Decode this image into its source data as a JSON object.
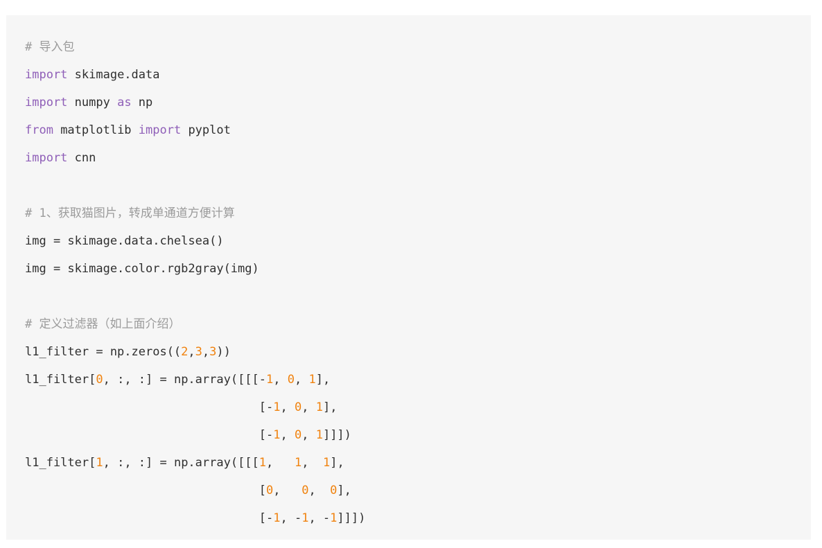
{
  "document": {
    "type": "python-code-block",
    "background_color": "#f6f6f6",
    "page_background_color": "#ffffff",
    "colors": {
      "comment": "#9b9b9b",
      "keyword": "#8f5fb8",
      "number": "#f0820e",
      "text": "#2f2f2f"
    }
  },
  "code": {
    "language": "python",
    "lines": [
      {
        "index": 1,
        "text": "# 导入包",
        "tokens": [
          {
            "t": "# 导入包",
            "c": "tok-com"
          }
        ]
      },
      {
        "index": 2,
        "text": "import skimage.data",
        "tokens": [
          {
            "t": "import",
            "c": "tok-kw"
          },
          {
            "t": " skimage.data",
            "c": "tok-txt"
          }
        ]
      },
      {
        "index": 3,
        "text": "import numpy as np",
        "tokens": [
          {
            "t": "import",
            "c": "tok-kw"
          },
          {
            "t": " numpy ",
            "c": "tok-txt"
          },
          {
            "t": "as",
            "c": "tok-kw"
          },
          {
            "t": " np",
            "c": "tok-txt"
          }
        ]
      },
      {
        "index": 4,
        "text": "from matplotlib import pyplot",
        "tokens": [
          {
            "t": "from",
            "c": "tok-kw"
          },
          {
            "t": " matplotlib ",
            "c": "tok-txt"
          },
          {
            "t": "import",
            "c": "tok-kw"
          },
          {
            "t": " pyplot",
            "c": "tok-txt"
          }
        ]
      },
      {
        "index": 5,
        "text": "import cnn",
        "tokens": [
          {
            "t": "import",
            "c": "tok-kw"
          },
          {
            "t": " cnn",
            "c": "tok-txt"
          }
        ]
      },
      {
        "index": 6,
        "text": "",
        "tokens": []
      },
      {
        "index": 7,
        "text": "# 1、获取猫图片，转成单通道方便计算",
        "tokens": [
          {
            "t": "# 1、获取猫图片，转成单通道方便计算",
            "c": "tok-com"
          }
        ]
      },
      {
        "index": 8,
        "text": "img = skimage.data.chelsea()",
        "tokens": [
          {
            "t": "img = skimage.data.chelsea()",
            "c": "tok-txt"
          }
        ]
      },
      {
        "index": 9,
        "text": "img = skimage.color.rgb2gray(img)",
        "tokens": [
          {
            "t": "img = skimage.color.rgb2gray(img)",
            "c": "tok-txt"
          }
        ]
      },
      {
        "index": 10,
        "text": "",
        "tokens": []
      },
      {
        "index": 11,
        "text": "# 定义过滤器（如上面介绍）",
        "tokens": [
          {
            "t": "# 定义过滤器（如上面介绍）",
            "c": "tok-com"
          }
        ]
      },
      {
        "index": 12,
        "text": "l1_filter = np.zeros((2,3,3))",
        "tokens": [
          {
            "t": "l1_filter = np.zeros((",
            "c": "tok-txt"
          },
          {
            "t": "2",
            "c": "tok-num"
          },
          {
            "t": ",",
            "c": "tok-txt"
          },
          {
            "t": "3",
            "c": "tok-num"
          },
          {
            "t": ",",
            "c": "tok-txt"
          },
          {
            "t": "3",
            "c": "tok-num"
          },
          {
            "t": "))",
            "c": "tok-txt"
          }
        ]
      },
      {
        "index": 13,
        "text": "l1_filter[0, :, :] = np.array([[[-1, 0, 1],",
        "tokens": [
          {
            "t": "l1_filter[",
            "c": "tok-txt"
          },
          {
            "t": "0",
            "c": "tok-num"
          },
          {
            "t": ", :, :] = np.array([[[-",
            "c": "tok-txt"
          },
          {
            "t": "1",
            "c": "tok-num"
          },
          {
            "t": ", ",
            "c": "tok-txt"
          },
          {
            "t": "0",
            "c": "tok-num"
          },
          {
            "t": ", ",
            "c": "tok-txt"
          },
          {
            "t": "1",
            "c": "tok-num"
          },
          {
            "t": "],",
            "c": "tok-txt"
          }
        ]
      },
      {
        "index": 14,
        "text": "                                 [-1, 0, 1],",
        "tokens": [
          {
            "t": "                                 [-",
            "c": "tok-txt"
          },
          {
            "t": "1",
            "c": "tok-num"
          },
          {
            "t": ", ",
            "c": "tok-txt"
          },
          {
            "t": "0",
            "c": "tok-num"
          },
          {
            "t": ", ",
            "c": "tok-txt"
          },
          {
            "t": "1",
            "c": "tok-num"
          },
          {
            "t": "],",
            "c": "tok-txt"
          }
        ]
      },
      {
        "index": 15,
        "text": "                                 [-1, 0, 1]]])",
        "tokens": [
          {
            "t": "                                 [-",
            "c": "tok-txt"
          },
          {
            "t": "1",
            "c": "tok-num"
          },
          {
            "t": ", ",
            "c": "tok-txt"
          },
          {
            "t": "0",
            "c": "tok-num"
          },
          {
            "t": ", ",
            "c": "tok-txt"
          },
          {
            "t": "1",
            "c": "tok-num"
          },
          {
            "t": "]]])",
            "c": "tok-txt"
          }
        ]
      },
      {
        "index": 16,
        "text": "l1_filter[1, :, :] = np.array([[[1,   1,  1],",
        "tokens": [
          {
            "t": "l1_filter[",
            "c": "tok-txt"
          },
          {
            "t": "1",
            "c": "tok-num"
          },
          {
            "t": ", :, :] = np.array([[[",
            "c": "tok-txt"
          },
          {
            "t": "1",
            "c": "tok-num"
          },
          {
            "t": ",   ",
            "c": "tok-txt"
          },
          {
            "t": "1",
            "c": "tok-num"
          },
          {
            "t": ",  ",
            "c": "tok-txt"
          },
          {
            "t": "1",
            "c": "tok-num"
          },
          {
            "t": "],",
            "c": "tok-txt"
          }
        ]
      },
      {
        "index": 17,
        "text": "                                 [0,   0,  0],",
        "tokens": [
          {
            "t": "                                 [",
            "c": "tok-txt"
          },
          {
            "t": "0",
            "c": "tok-num"
          },
          {
            "t": ",   ",
            "c": "tok-txt"
          },
          {
            "t": "0",
            "c": "tok-num"
          },
          {
            "t": ",  ",
            "c": "tok-txt"
          },
          {
            "t": "0",
            "c": "tok-num"
          },
          {
            "t": "],",
            "c": "tok-txt"
          }
        ]
      },
      {
        "index": 18,
        "text": "                                 [-1, -1, -1]]])",
        "tokens": [
          {
            "t": "                                 [-",
            "c": "tok-txt"
          },
          {
            "t": "1",
            "c": "tok-num"
          },
          {
            "t": ", -",
            "c": "tok-txt"
          },
          {
            "t": "1",
            "c": "tok-num"
          },
          {
            "t": ", -",
            "c": "tok-txt"
          },
          {
            "t": "1",
            "c": "tok-num"
          },
          {
            "t": "]]])",
            "c": "tok-txt"
          }
        ]
      }
    ]
  }
}
